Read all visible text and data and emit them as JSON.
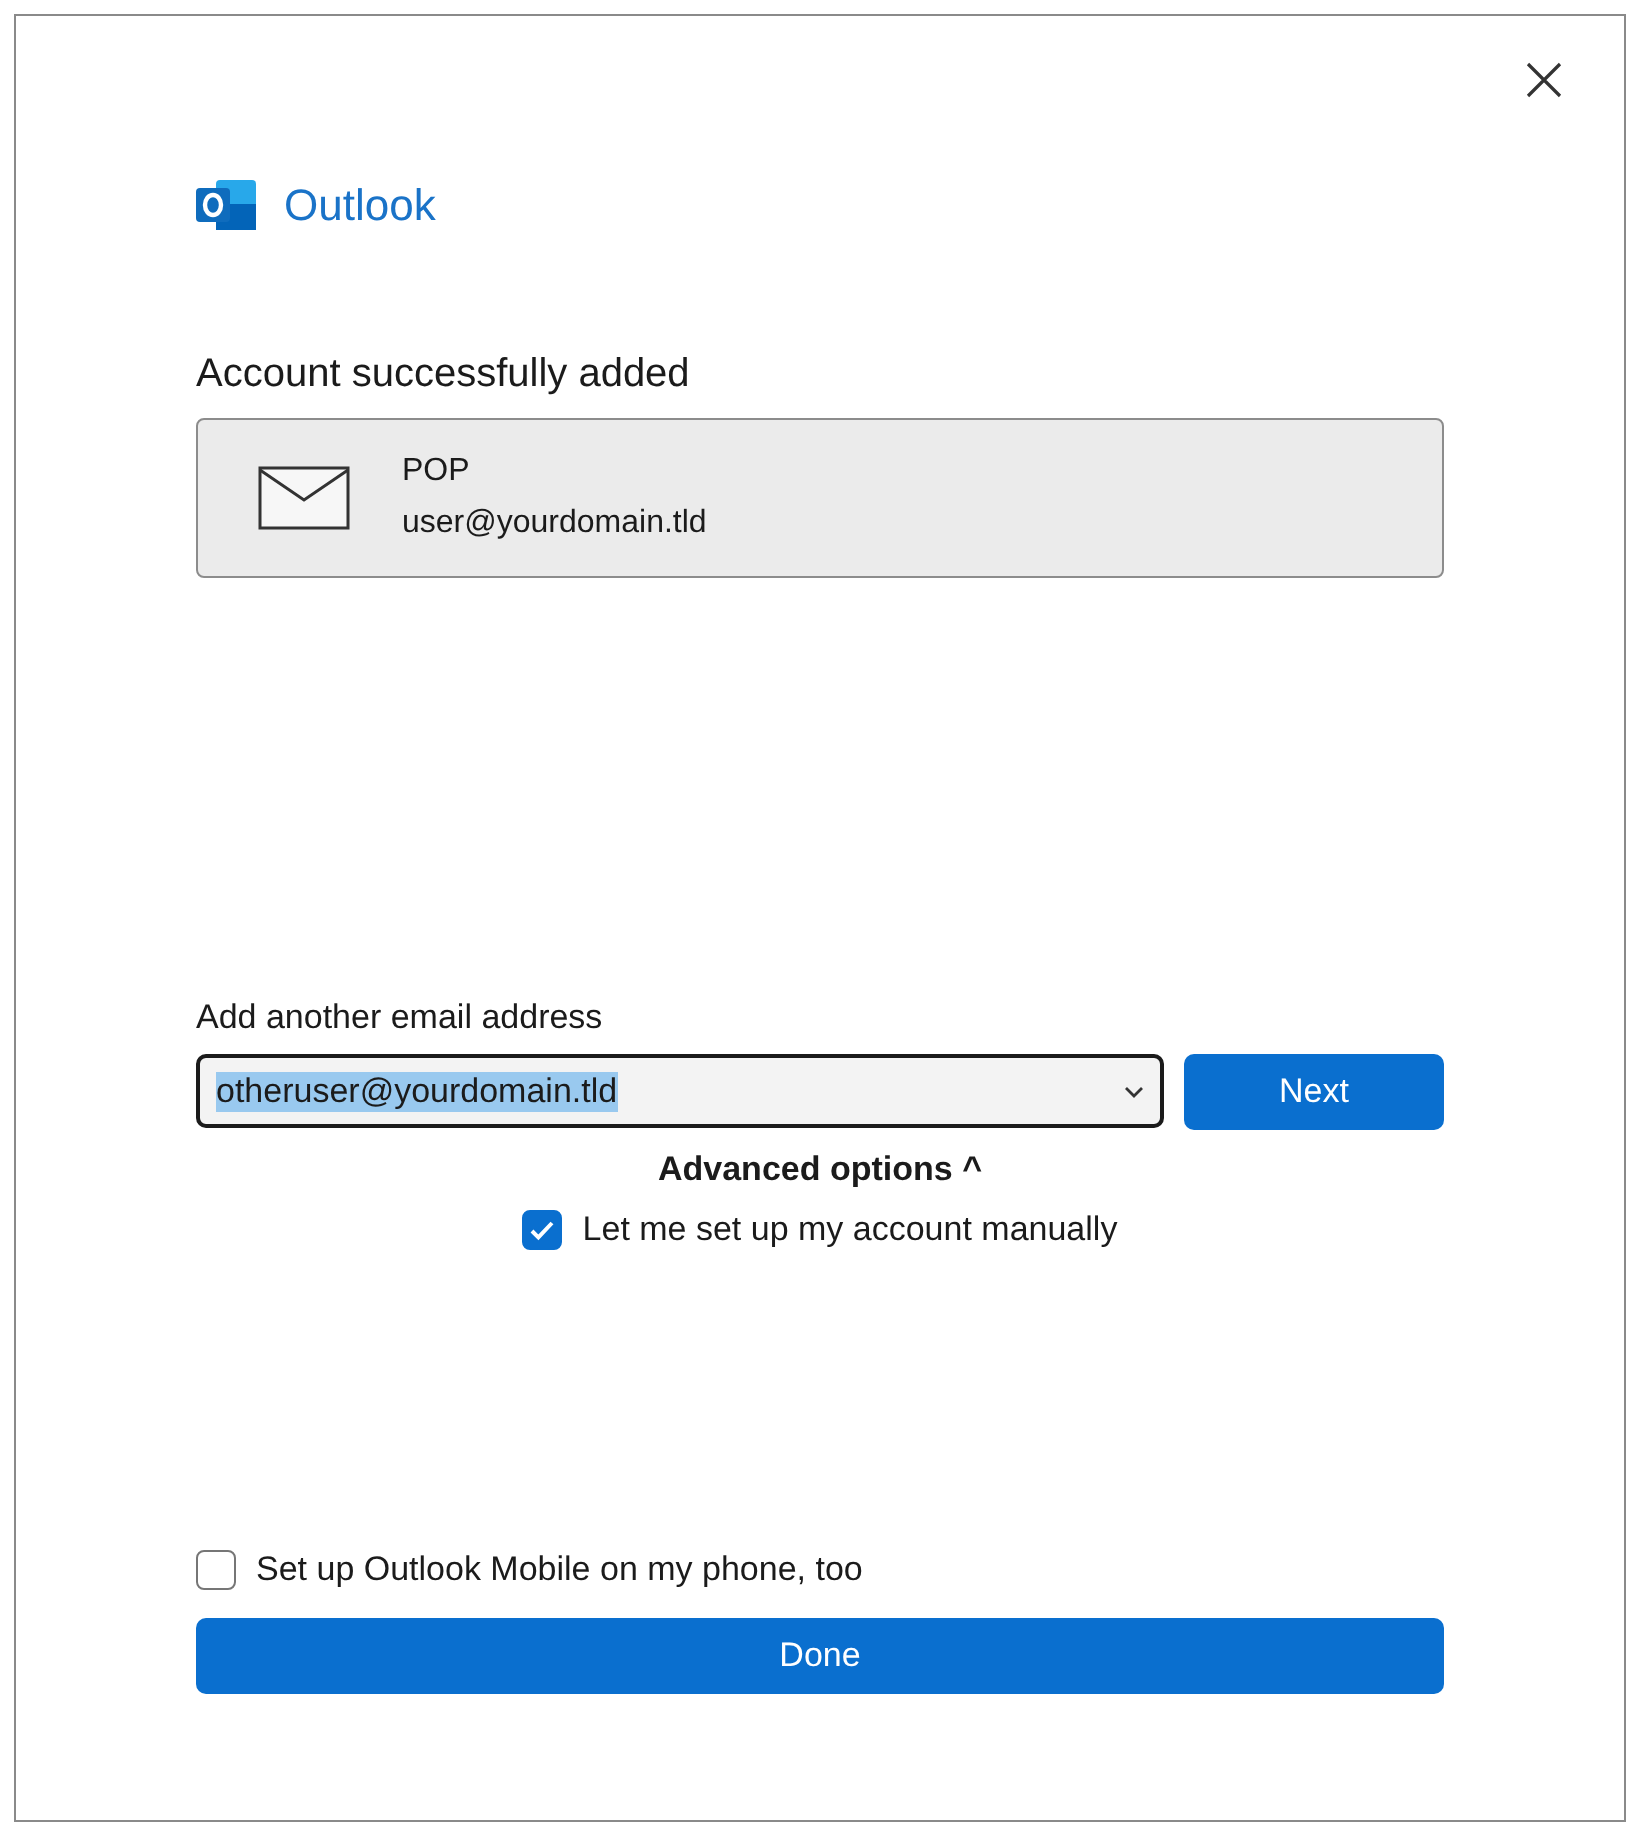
{
  "brand": {
    "name": "Outlook"
  },
  "heading": "Account successfully added",
  "account": {
    "type": "POP",
    "email": "user@yourdomain.tld"
  },
  "add_email": {
    "label": "Add another email address",
    "value": "otheruser@yourdomain.tld",
    "text_highlighted": true,
    "next_button": "Next"
  },
  "advanced": {
    "label": "Advanced options",
    "expanded": true,
    "caret": "^"
  },
  "manual_setup": {
    "label": "Let me set up my account manually",
    "checked": true
  },
  "mobile_setup": {
    "label": "Set up Outlook Mobile on my phone, too",
    "checked": false
  },
  "done_button": "Done"
}
